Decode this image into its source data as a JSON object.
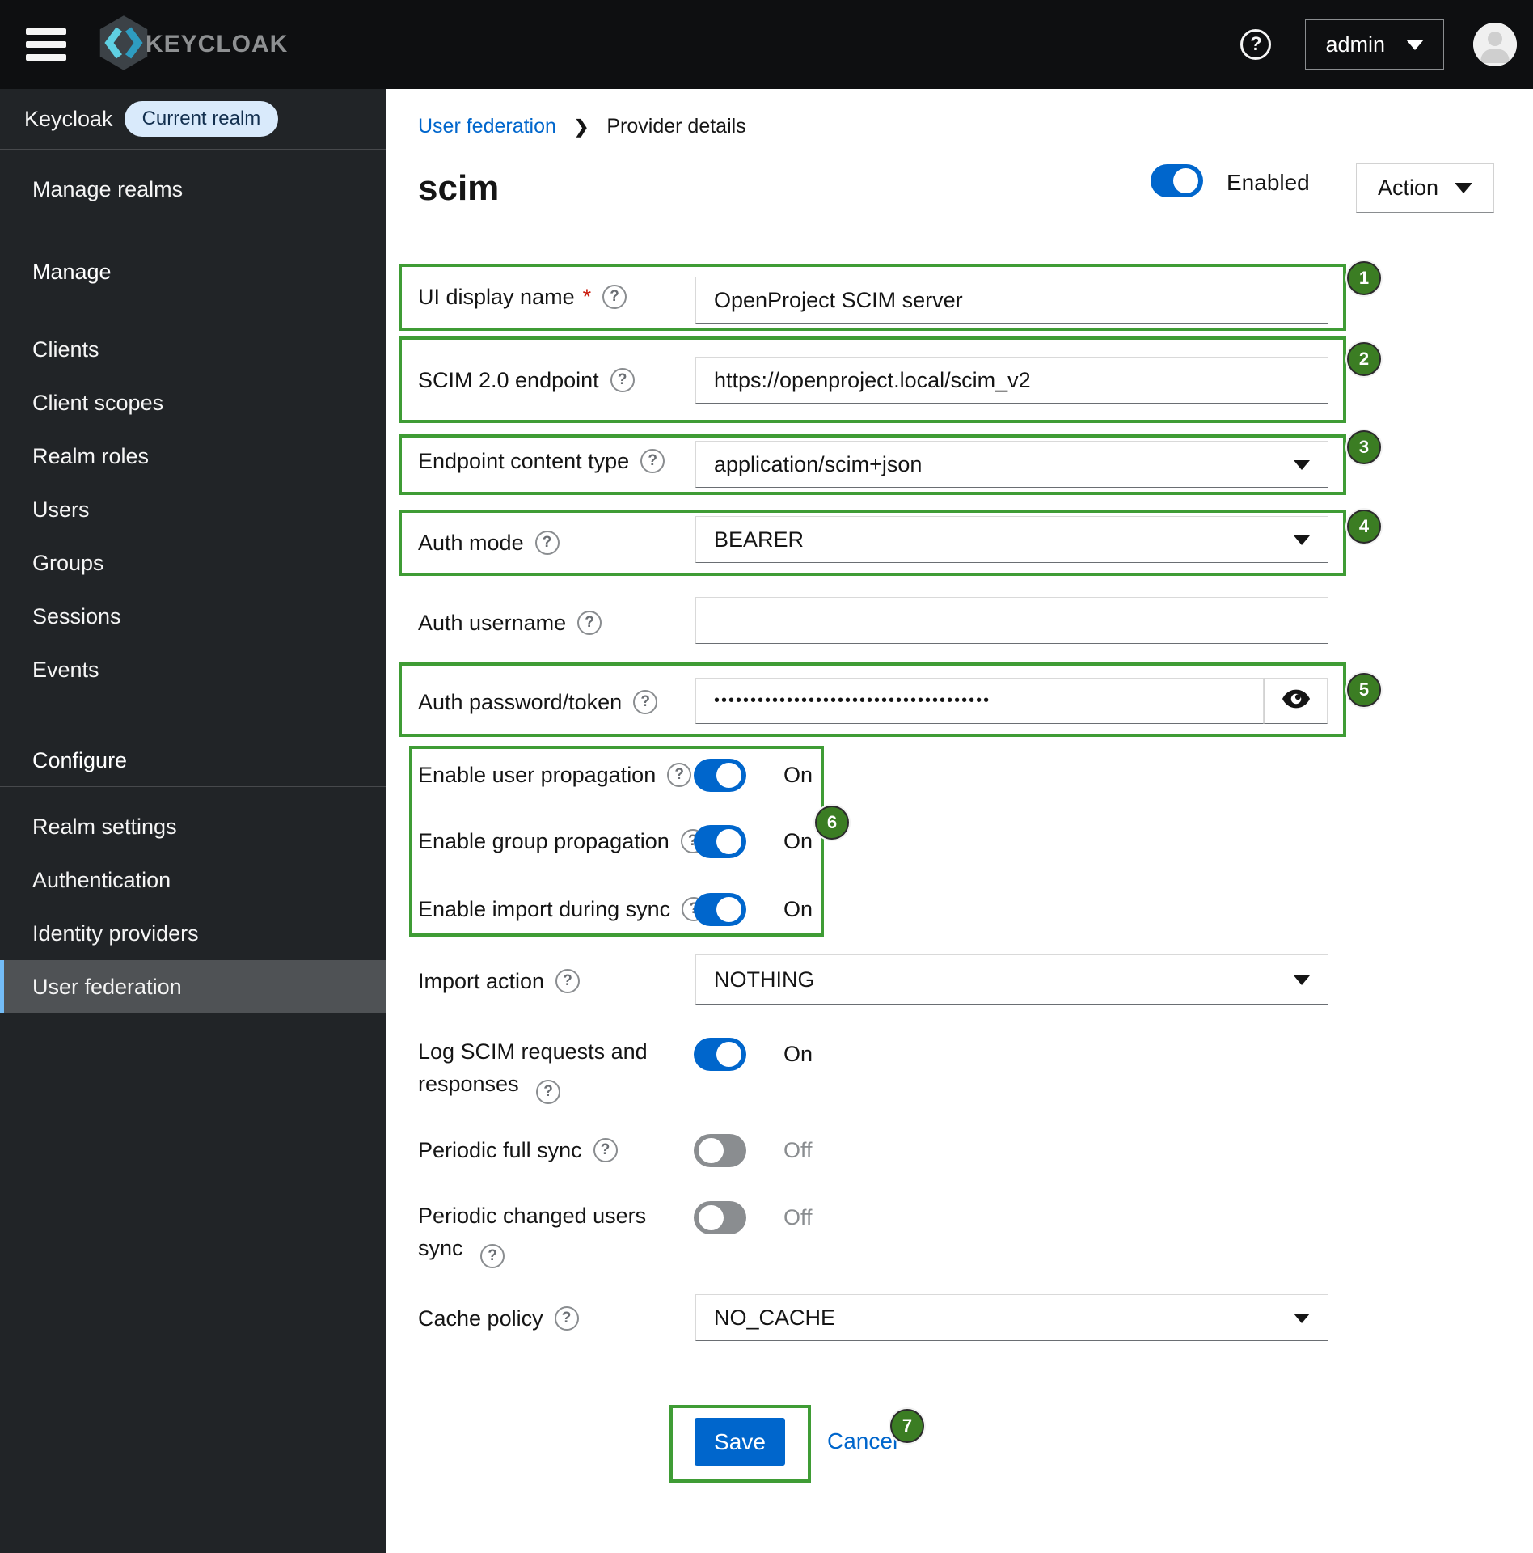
{
  "masthead": {
    "brand": "KEYCLOAK",
    "user_menu": "admin"
  },
  "sidebar": {
    "realm_label": "Keycloak",
    "realm_badge": "Current realm",
    "top_items": [
      {
        "label": "Manage realms"
      }
    ],
    "sections": [
      {
        "title": "Manage",
        "items": [
          "Clients",
          "Client scopes",
          "Realm roles",
          "Users",
          "Groups",
          "Sessions",
          "Events"
        ]
      },
      {
        "title": "Configure",
        "items": [
          "Realm settings",
          "Authentication",
          "Identity providers",
          "User federation"
        ]
      }
    ],
    "selected_item": "User federation"
  },
  "breadcrumb": {
    "parent": "User federation",
    "current": "Provider details"
  },
  "page": {
    "title": "scim",
    "enabled_label": "Enabled",
    "action_label": "Action"
  },
  "form": {
    "ui_display_name": {
      "label": "UI display name",
      "required_marker": "*",
      "value": "OpenProject SCIM server"
    },
    "scim_endpoint": {
      "label": "SCIM 2.0 endpoint",
      "value": "https://openproject.local/scim_v2"
    },
    "endpoint_content_type": {
      "label": "Endpoint content type",
      "value": "application/scim+json"
    },
    "auth_mode": {
      "label": "Auth mode",
      "value": "BEARER"
    },
    "auth_username": {
      "label": "Auth username",
      "value": ""
    },
    "auth_password": {
      "label": "Auth password/token",
      "masked_value": "••••••••••••••••••••••••••••••••••••••"
    },
    "enable_user_propagation": {
      "label": "Enable user propagation",
      "state": "On"
    },
    "enable_group_propagation": {
      "label": "Enable group propagation",
      "state": "On"
    },
    "enable_import_during_sync": {
      "label": "Enable import during sync",
      "state": "On"
    },
    "import_action": {
      "label": "Import action",
      "value": "NOTHING"
    },
    "log_scim_requests": {
      "label": "Log SCIM requests and responses",
      "state": "On"
    },
    "periodic_full_sync": {
      "label": "Periodic full sync",
      "state": "Off"
    },
    "periodic_changed_users_sync": {
      "label": "Periodic changed users sync",
      "state": "Off"
    },
    "cache_policy": {
      "label": "Cache policy",
      "value": "NO_CACHE"
    },
    "save_label": "Save",
    "cancel_label": "Cancel",
    "help_glyph": "?"
  },
  "annotations": {
    "badges": [
      "1",
      "2",
      "3",
      "4",
      "5",
      "6",
      "7"
    ]
  },
  "colors": {
    "annotation_green": "#3f9c35",
    "badge_green": "#3b7d23",
    "primary_blue": "#0066cc",
    "toggle_off_gray": "#8a8d90",
    "masthead_black": "#0e0f11",
    "sidebar_dark": "#212427",
    "realm_pill_bg": "#d9eafb",
    "required_red": "#c9190b"
  }
}
